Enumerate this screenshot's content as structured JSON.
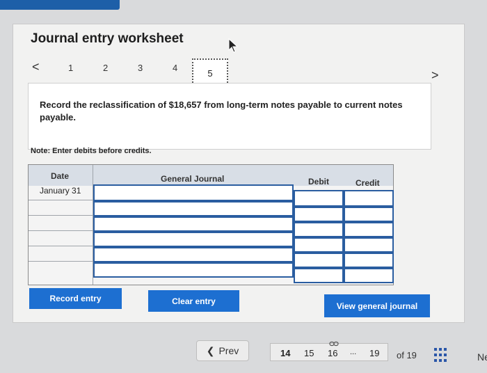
{
  "title": "Journal entry worksheet",
  "steps": [
    "1",
    "2",
    "3",
    "4",
    "5"
  ],
  "active_step": "5",
  "instruction": "Record the reclassification of $18,657 from long-term notes payable to current notes payable.",
  "note": "Note: Enter debits before credits.",
  "journal": {
    "headers": {
      "date": "Date",
      "general": "General Journal",
      "debit": "Debit",
      "credit": "Credit"
    },
    "first_date": "January 31",
    "rows": 6
  },
  "buttons": {
    "record": "Record entry",
    "clear": "Clear entry",
    "view": "View general journal"
  },
  "pager": {
    "prev": "Prev",
    "pages": [
      "14",
      "15",
      "16",
      "...",
      "19"
    ],
    "of": "of 19",
    "next_partial": "Ne"
  },
  "colors": {
    "accent": "#1d6fd1",
    "header_bg": "#d8dee6",
    "field_border": "#2a5da0"
  }
}
